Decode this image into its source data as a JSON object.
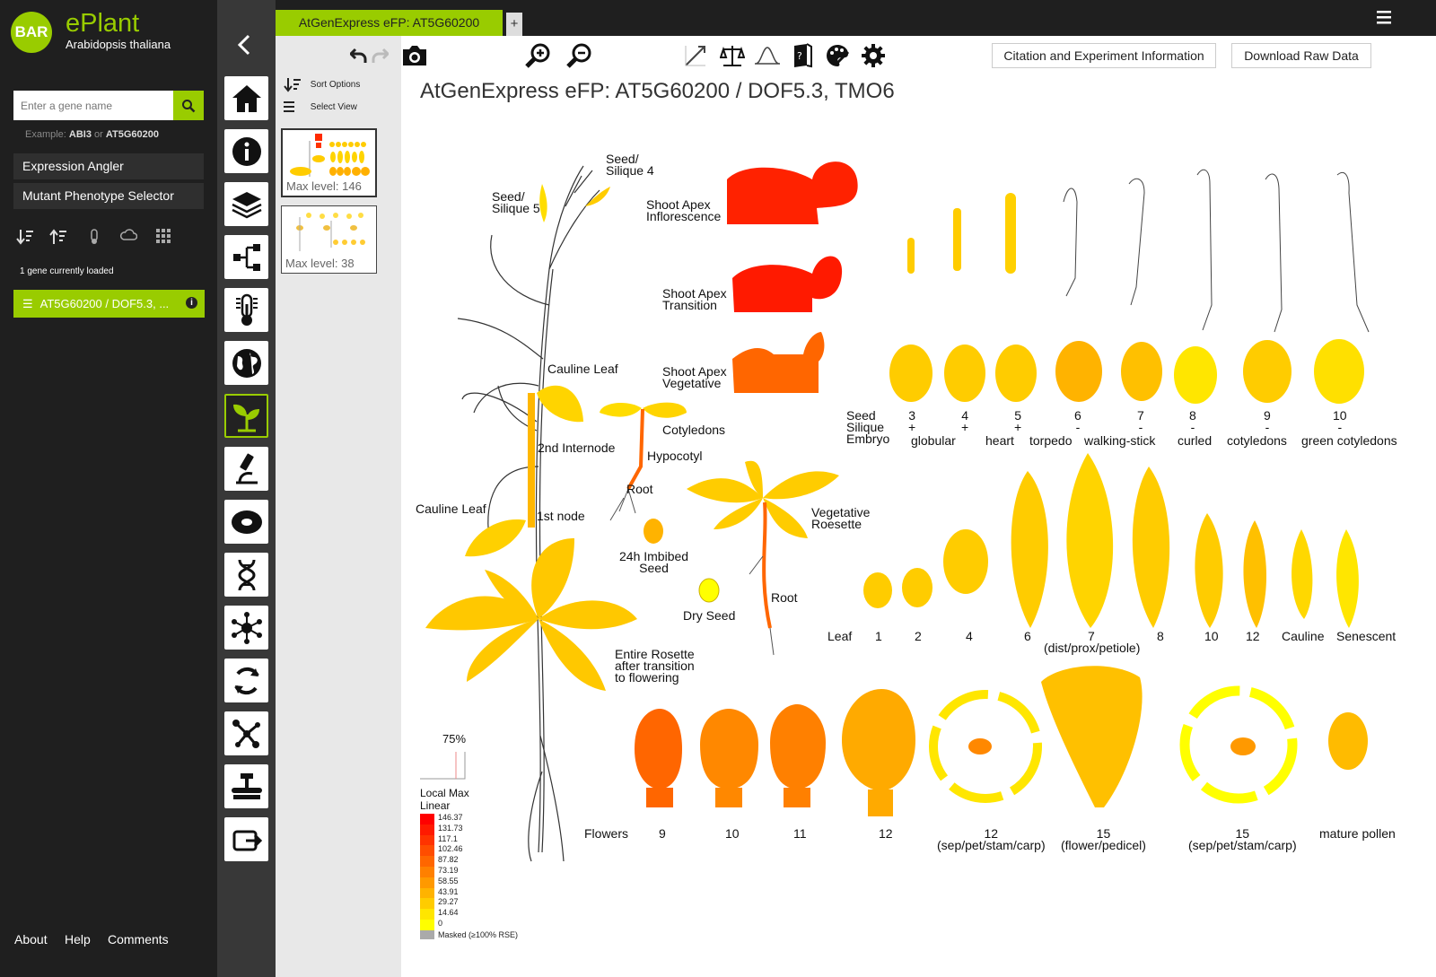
{
  "sidebar": {
    "logo": "BAR",
    "app_name": "ePlant",
    "species": "Arabidopsis thaliana",
    "search_placeholder": "Enter a gene name",
    "example_prefix": "Example:",
    "example_1": "ABI3",
    "example_or": "or",
    "example_2": "AT5G60200",
    "buttons": [
      "Expression Angler",
      "Mutant Phenotype Selector"
    ],
    "gene_count": "1 gene currently loaded",
    "loaded_gene": "AT5G60200 / DOF5.3, ...",
    "footer": [
      "About",
      "Help",
      "Comments"
    ]
  },
  "rail": {
    "items": [
      "home-icon",
      "info-icon",
      "layers-icon",
      "tree-icon",
      "thermometer-icon",
      "globe-icon",
      "plant-icon",
      "microscope-icon",
      "cell-icon",
      "dna-icon",
      "network-icon",
      "cycle-icon",
      "molecule-icon",
      "chromosome-icon",
      "export-icon"
    ],
    "active": "plant-icon"
  },
  "tabs": {
    "active": "AtGenExpress eFP: AT5G60200",
    "add": "+"
  },
  "panel": {
    "sort_options": "Sort Options",
    "select_view": "Select View",
    "thumb_1": "Max level: 146",
    "thumb_2": "Max level: 38"
  },
  "toolbar": {
    "citation": "Citation and Experiment Information",
    "download": "Download Raw Data"
  },
  "view": {
    "title": "AtGenExpress eFP: AT5G60200 / DOF5.3, TMO6"
  },
  "labels": {
    "seed_silique_4": "Seed/\nSilique 4",
    "seed_silique_5": "Seed/\nSilique 5",
    "shoot_apex_inflo": "Shoot Apex\nInflorescence",
    "shoot_apex_trans": "Shoot Apex\nTransition",
    "shoot_apex_veg": "Shoot Apex\nVegetative",
    "cauline_leaf_top": "Cauline Leaf",
    "internode2": "2nd Internode",
    "cauline_leaf_bottom": "Cauline Leaf",
    "node1": "1st node",
    "cotyledons": "Cotyledons",
    "hypocotyl": "Hypocotyl",
    "root_small": "Root",
    "imbibed": "24h Imbibed\nSeed",
    "dry_seed": "Dry Seed",
    "veg_rosette": "Vegetative\nRoesette",
    "root_big": "Root",
    "entire_rosette": "Entire Rosette\nafter transition\nto flowering",
    "seed_silique_embryo": "Seed\nSilique\nEmbryo",
    "embryo_nums": [
      "3\n+",
      "4\n+",
      "5\n+",
      "6\n-",
      "7\n-",
      "8\n-",
      "9\n-",
      "10\n-"
    ],
    "embryo_stages": [
      "globular",
      "heart",
      "torpedo",
      "walking-stick",
      "curled",
      "cotyledons",
      "green cotyledons"
    ],
    "leaf": "Leaf",
    "leaf_nums": [
      "1",
      "2",
      "4",
      "6",
      "7",
      "8",
      "10",
      "12",
      "Cauline",
      "Senescent"
    ],
    "leaf7_sub": "(dist/prox/petiole)",
    "flowers": "Flowers",
    "flower_nums": [
      "9",
      "10",
      "11",
      "12"
    ],
    "f12_sep": "12\n(sep/pet/stam/carp)",
    "f15_fp": "15\n(flower/pedicel)",
    "f15_sep": "15\n(sep/pet/stam/carp)",
    "mature_pollen": "mature pollen"
  },
  "legend": {
    "percent": "75%",
    "mode_1": "Local Max",
    "mode_2": "Linear",
    "values": [
      "146.37",
      "131.73",
      "117.1",
      "102.46",
      "87.82",
      "73.19",
      "58.55",
      "43.91",
      "29.27",
      "14.64",
      "0"
    ],
    "masked": "Masked (≥100% RSE)",
    "colors": [
      "#ff0000",
      "#ff1a00",
      "#ff3300",
      "#ff4d00",
      "#ff6600",
      "#ff8000",
      "#ff9900",
      "#ffb300",
      "#ffcc00",
      "#ffe600",
      "#ffff00"
    ]
  },
  "colors": {
    "accent": "#99cc00",
    "dark": "#1f1f1f",
    "rail": "#383838"
  }
}
